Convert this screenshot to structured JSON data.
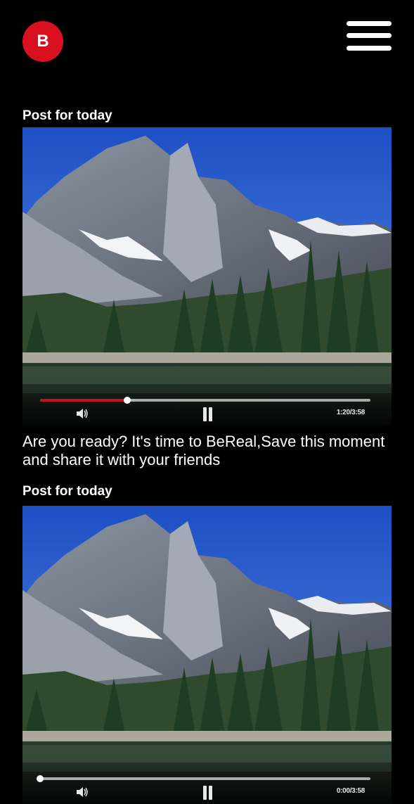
{
  "header": {
    "logo_letter": "B",
    "menu_icon": "hamburger-menu-icon",
    "brand_color": "#d8101f"
  },
  "posts": [
    {
      "title": "Post for today",
      "media_icon_volume": "volume-icon",
      "media_icon_pause": "pause-icon",
      "time": "1:20/3:58",
      "progress": 0.263,
      "caption": "Are you ready? It's time to BeReal,Save this moment and share it with your friends"
    },
    {
      "title": "Post for today",
      "media_icon_volume": "volume-icon",
      "media_icon_pause": "pause-icon",
      "time": "0:00/3:58",
      "progress": 0
    }
  ],
  "colors": {
    "background": "#000000",
    "progress_fill": "#c1121f"
  }
}
